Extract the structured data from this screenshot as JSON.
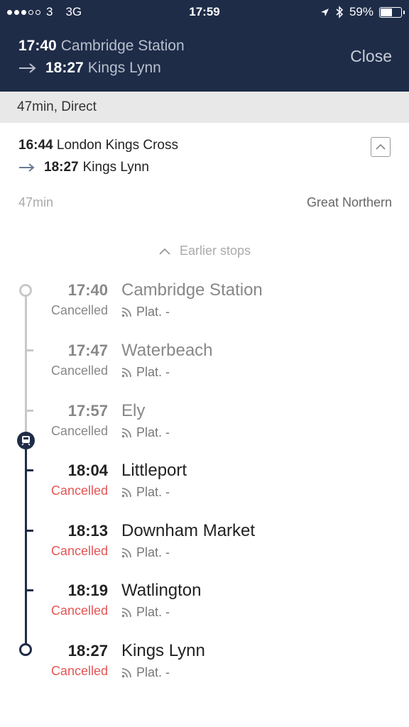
{
  "status_bar": {
    "carrier": "3",
    "network": "3G",
    "time": "17:59",
    "battery": "59%"
  },
  "header": {
    "depart_time": "17:40",
    "depart_station": "Cambridge Station",
    "arrive_time": "18:27",
    "arrive_station": "Kings Lynn",
    "close_label": "Close"
  },
  "summary": "47min, Direct",
  "journey": {
    "origin_time": "16:44",
    "origin_station": "London Kings Cross",
    "dest_time": "18:27",
    "dest_station": "Kings Lynn",
    "duration": "47min",
    "operator": "Great Northern"
  },
  "earlier_stops_label": "Earlier stops",
  "stops": [
    {
      "time": "17:40",
      "name": "Cambridge Station",
      "status": "Cancelled",
      "platform": "Plat. -"
    },
    {
      "time": "17:47",
      "name": "Waterbeach",
      "status": "Cancelled",
      "platform": "Plat. -"
    },
    {
      "time": "17:57",
      "name": "Ely",
      "status": "Cancelled",
      "platform": "Plat. -"
    },
    {
      "time": "18:04",
      "name": "Littleport",
      "status": "Cancelled",
      "platform": "Plat. -"
    },
    {
      "time": "18:13",
      "name": "Downham Market",
      "status": "Cancelled",
      "platform": "Plat. -"
    },
    {
      "time": "18:19",
      "name": "Watlington",
      "status": "Cancelled",
      "platform": "Plat. -"
    },
    {
      "time": "18:27",
      "name": "Kings Lynn",
      "status": "Cancelled",
      "platform": "Plat. -"
    }
  ],
  "colors": {
    "header_bg": "#1f2c48",
    "cancelled": "#e45555",
    "past_line": "#c8c8c8",
    "active_line": "#1f2c48"
  }
}
